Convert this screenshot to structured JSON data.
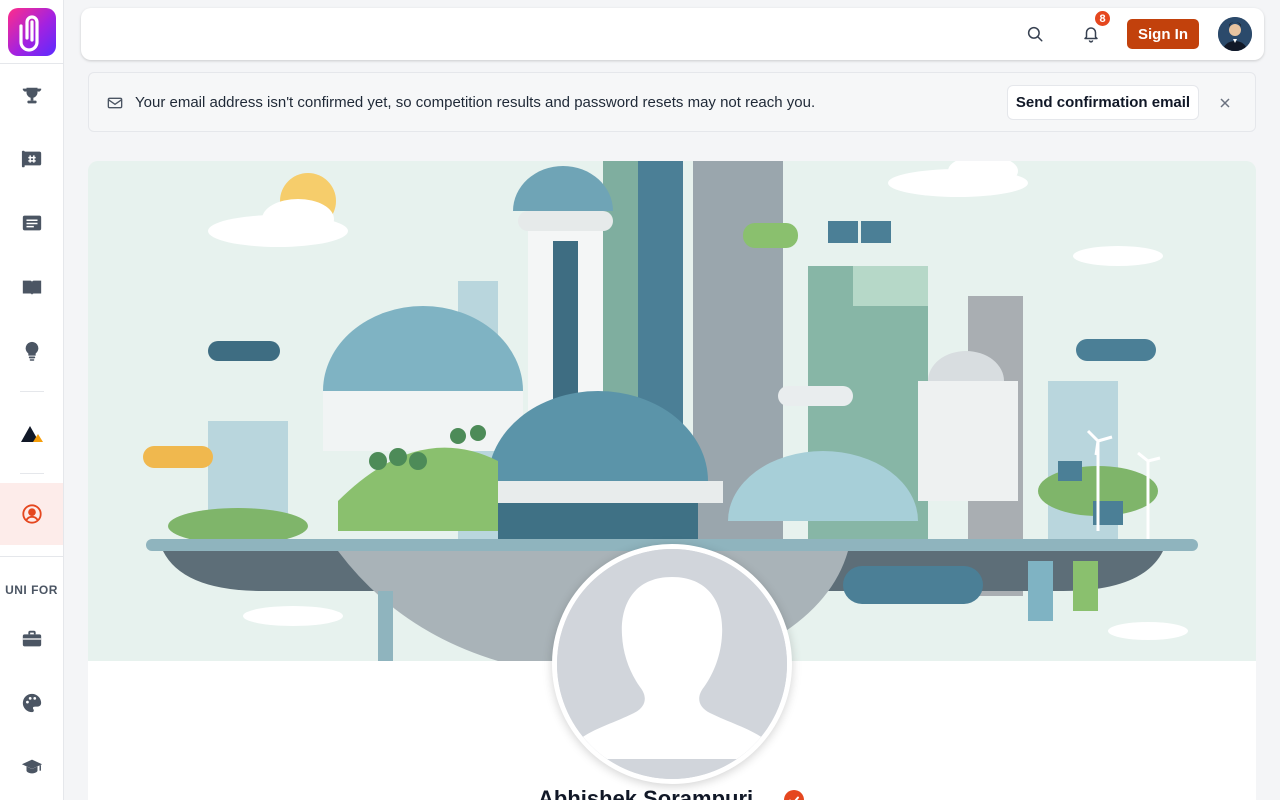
{
  "sidebar": {
    "section_label": "UNI FOR",
    "items": [
      {
        "icon": "trophy-icon"
      },
      {
        "icon": "hashtag-board-icon"
      },
      {
        "icon": "list-card-icon"
      },
      {
        "icon": "open-book-icon"
      },
      {
        "icon": "lightbulb-icon"
      },
      {
        "icon": "mountain-peak-icon"
      },
      {
        "icon": "profile-circle-icon",
        "active": true
      },
      {
        "icon": "briefcase-icon"
      },
      {
        "icon": "palette-icon"
      },
      {
        "icon": "graduation-cap-icon"
      }
    ]
  },
  "header": {
    "notification_count": "8",
    "signin_label": "Sign In"
  },
  "notice": {
    "message": "Your email address isn't confirmed yet, so competition results and password resets may not reach you.",
    "button_label": "Send confirmation email"
  },
  "profile": {
    "name": "Abhishek Sorampuri"
  },
  "colors": {
    "accent": "#c2410c",
    "badge": "#e5471f",
    "active_bg": "#fdecea",
    "cover_bg": "#e7f2ee"
  }
}
